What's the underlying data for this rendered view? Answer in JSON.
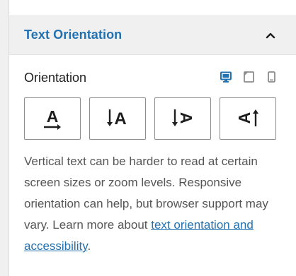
{
  "header": {
    "title": "Text Orientation"
  },
  "orientation": {
    "label": "Orientation",
    "devices": [
      {
        "name": "desktop",
        "active": true
      },
      {
        "name": "tablet",
        "active": false
      },
      {
        "name": "mobile",
        "active": false
      }
    ],
    "options": [
      {
        "name": "horizontal",
        "glyph": "A"
      },
      {
        "name": "vertical-upright",
        "glyph": "A"
      },
      {
        "name": "vertical-right",
        "glyph": "A"
      },
      {
        "name": "vertical-left",
        "glyph": "A"
      }
    ]
  },
  "help": {
    "text": "Vertical text can be harder to read at certain screen sizes or zoom levels. Responsive orientation can help, but browser support may vary. Learn more about ",
    "link": "text orientation and accessibility",
    "end": "."
  },
  "colors": {
    "accent": "#2271b1",
    "header_bg": "#f0f0f0",
    "text": "#1e1e1e",
    "muted": "#555555",
    "icon_inactive": "#8c8c8c"
  }
}
